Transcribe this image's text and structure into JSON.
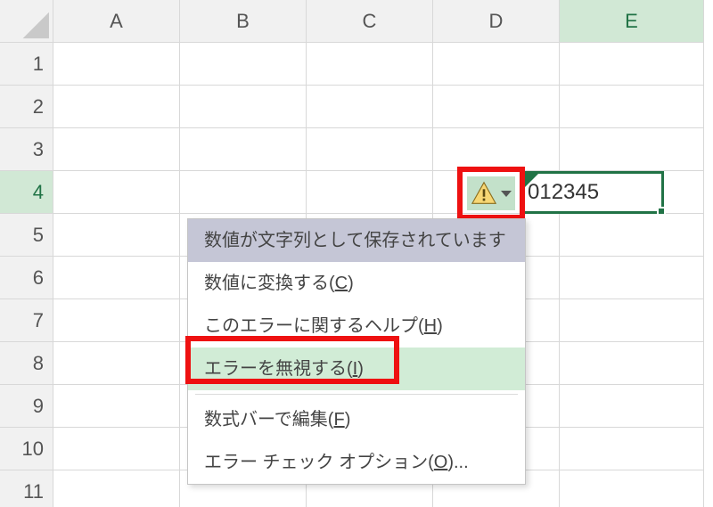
{
  "columns": [
    "A",
    "B",
    "C",
    "D",
    "E"
  ],
  "rows": [
    "1",
    "2",
    "3",
    "4",
    "5",
    "6",
    "7",
    "8",
    "9",
    "10",
    "11"
  ],
  "active_column_index": 4,
  "active_row_index": 3,
  "cell_value": "012345",
  "menu": {
    "title": "数値が文字列として保存されています",
    "items": [
      {
        "text": "数値に変換する(",
        "accel": "C",
        "suffix": ")"
      },
      {
        "text": "このエラーに関するヘルプ(",
        "accel": "H",
        "suffix": ")"
      },
      {
        "text": "エラーを無視する(",
        "accel": "I",
        "suffix": ")"
      },
      {
        "text": "数式バーで編集(",
        "accel": "F",
        "suffix": ")"
      },
      {
        "text": "エラー チェック オプション(",
        "accel": "O",
        "suffix": ")..."
      }
    ],
    "highlighted_index": 2
  },
  "icons": {
    "warning": "warning-icon",
    "dropdown": "chevron-down-icon"
  },
  "colors": {
    "accent": "#217346",
    "highlight_red": "#e11",
    "menu_title_bg": "#c5c6d6",
    "menu_hover_bg": "#d1ecd6"
  }
}
